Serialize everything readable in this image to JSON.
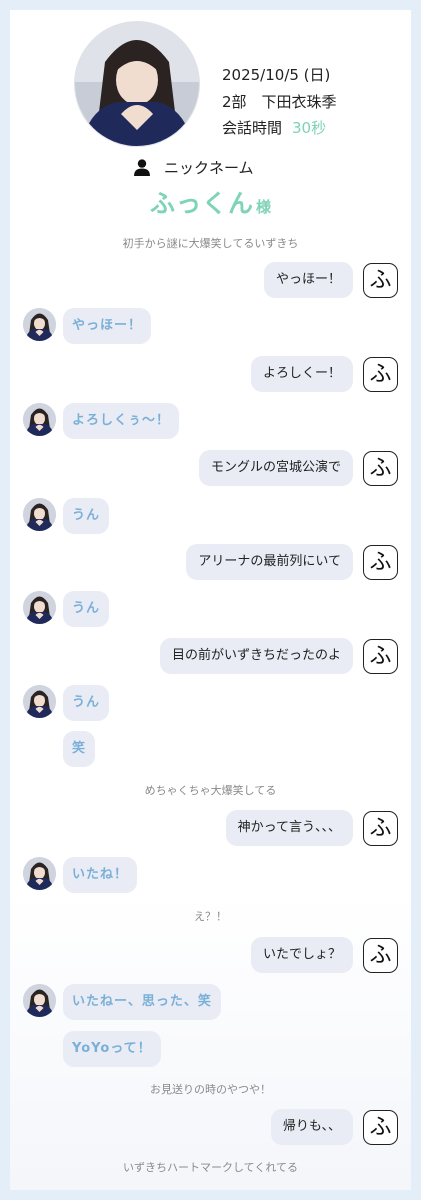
{
  "header": {
    "date": "2025/10/5 (日)",
    "session_member": "2部　下田衣珠季",
    "duration_label": "会話時間",
    "duration_value": "30秒",
    "nickname_label": "ニックネーム",
    "nickname": "ふっくん",
    "nickname_suffix": "様"
  },
  "icons": {
    "user": "person-icon",
    "self_avatar_glyph": "ふ"
  },
  "colors": {
    "accent_green": "#7fd4b6",
    "idol_text": "#7ab0d8",
    "bubble_bg": "#e9ecf5",
    "note_text": "#8a8a8a"
  },
  "conversation": [
    {
      "type": "note",
      "text": "初手から謎に大爆笑してるいずきち"
    },
    {
      "type": "me",
      "text": "やっほー！"
    },
    {
      "type": "idol",
      "text": "やっほー！"
    },
    {
      "type": "me",
      "text": "よろしくー！"
    },
    {
      "type": "idol",
      "text": "よろしくぅ〜！"
    },
    {
      "type": "me",
      "text": "モングルの宮城公演で"
    },
    {
      "type": "idol",
      "text": "うん"
    },
    {
      "type": "me",
      "text": "アリーナの最前列にいて"
    },
    {
      "type": "idol",
      "text": "うん"
    },
    {
      "type": "me",
      "text": "目の前がいずきちだったのよ"
    },
    {
      "type": "idol",
      "text": "うん"
    },
    {
      "type": "idol_cont",
      "text": "笑"
    },
    {
      "type": "note",
      "text": "めちゃくちゃ大爆笑してる"
    },
    {
      "type": "me",
      "text": "神かって言う、、、"
    },
    {
      "type": "idol",
      "text": "いたね！"
    },
    {
      "type": "note",
      "text": "え？！"
    },
    {
      "type": "me",
      "text": "いたでしょ？"
    },
    {
      "type": "idol",
      "text": "いたねー、思った、笑"
    },
    {
      "type": "idol_cont",
      "text": "YoYoって！"
    },
    {
      "type": "note",
      "text": "お見送りの時のやつや！"
    },
    {
      "type": "me",
      "text": "帰りも、、"
    },
    {
      "type": "note",
      "text": "いずきちハートマークしてくれてる"
    }
  ]
}
